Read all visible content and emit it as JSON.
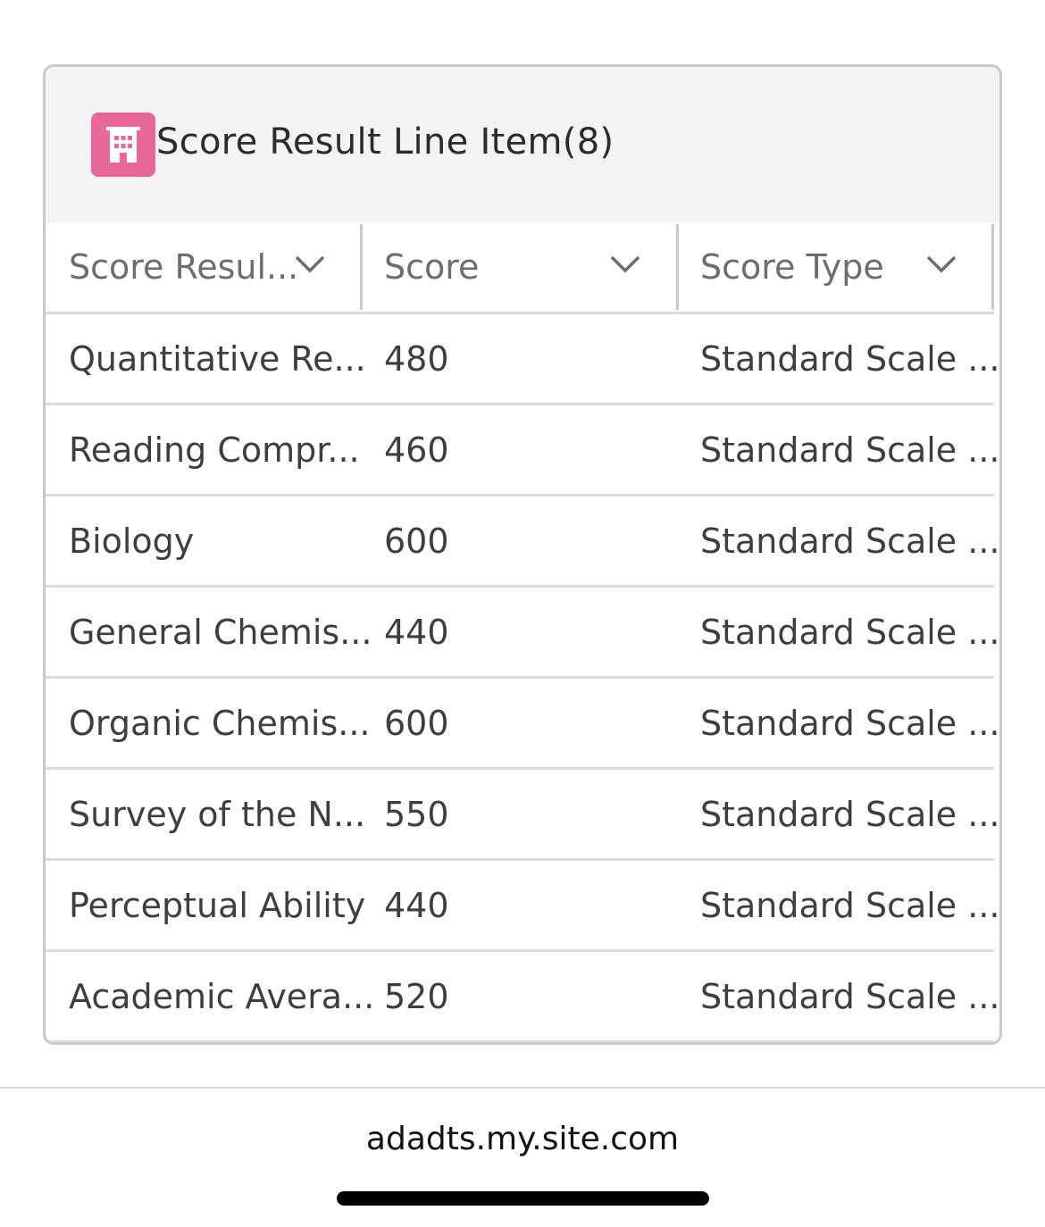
{
  "card": {
    "title": "Score Result Line Item(8)",
    "icon": "building-icon",
    "icon_color": "#e8689a"
  },
  "table": {
    "headers": [
      "Score Resul...",
      "Score",
      "Score Type"
    ],
    "rows": [
      [
        "Quantitative Re...",
        "480",
        "Standard Scale ..."
      ],
      [
        "Reading Compr...",
        "460",
        "Standard Scale ..."
      ],
      [
        "Biology",
        "600",
        "Standard Scale ..."
      ],
      [
        "General Chemis...",
        "440",
        "Standard Scale ..."
      ],
      [
        "Organic Chemis...",
        "600",
        "Standard Scale ..."
      ],
      [
        "Survey of the N...",
        "550",
        "Standard Scale ..."
      ],
      [
        "Perceptual Ability",
        "440",
        "Standard Scale ..."
      ],
      [
        "Academic Avera...",
        "520",
        "Standard Scale ..."
      ]
    ]
  },
  "browser": {
    "url": "adadts.my.site.com"
  }
}
